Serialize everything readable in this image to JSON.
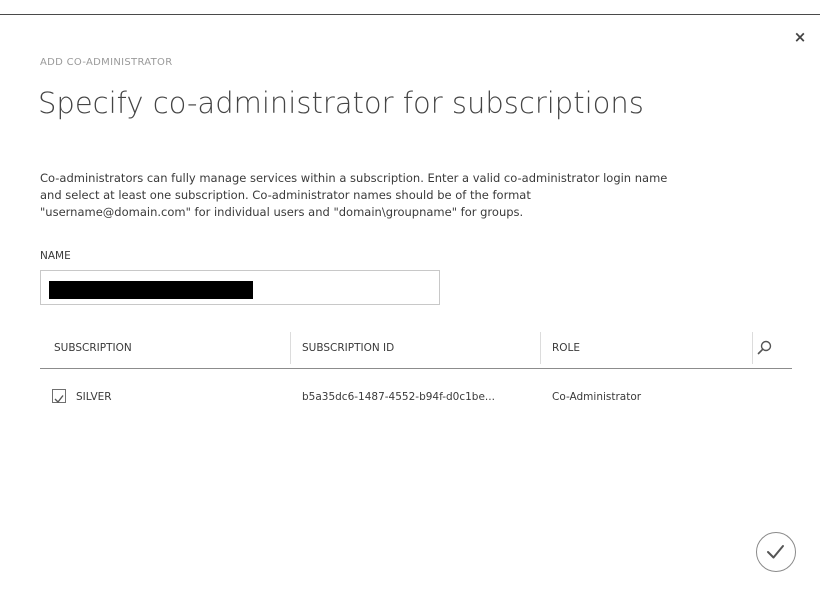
{
  "dialog": {
    "close_glyph": "×",
    "eyebrow": "ADD CO-ADMINISTRATOR",
    "title": "Specify co-administrator for subscriptions",
    "description": [
      "Co-administrators can fully manage services within a subscription. Enter a valid co-administrator login name",
      "and select at least one subscription. Co-administrator names should be of the format",
      "\"username@domain.com\" for individual users and \"domain\\groupname\" for groups."
    ],
    "name_label": "NAME",
    "name_value": ""
  },
  "table": {
    "columns": [
      "SUBSCRIPTION",
      "SUBSCRIPTION ID",
      "ROLE"
    ],
    "rows": [
      {
        "checked": true,
        "subscription": "SILVER",
        "subscription_id": "b5a35dc6-1487-4552-b94f-d0c1be...",
        "role": "Co-Administrator"
      }
    ]
  },
  "icons": {
    "close": "close-icon",
    "search": "search-icon",
    "confirm": "checkmark-icon",
    "checkbox": "checkbox-checked-icon"
  },
  "colors": {
    "title": "#444444",
    "eyebrow": "#9a9a9a",
    "text": "#3a3a3a",
    "border": "#c8c8c8"
  }
}
